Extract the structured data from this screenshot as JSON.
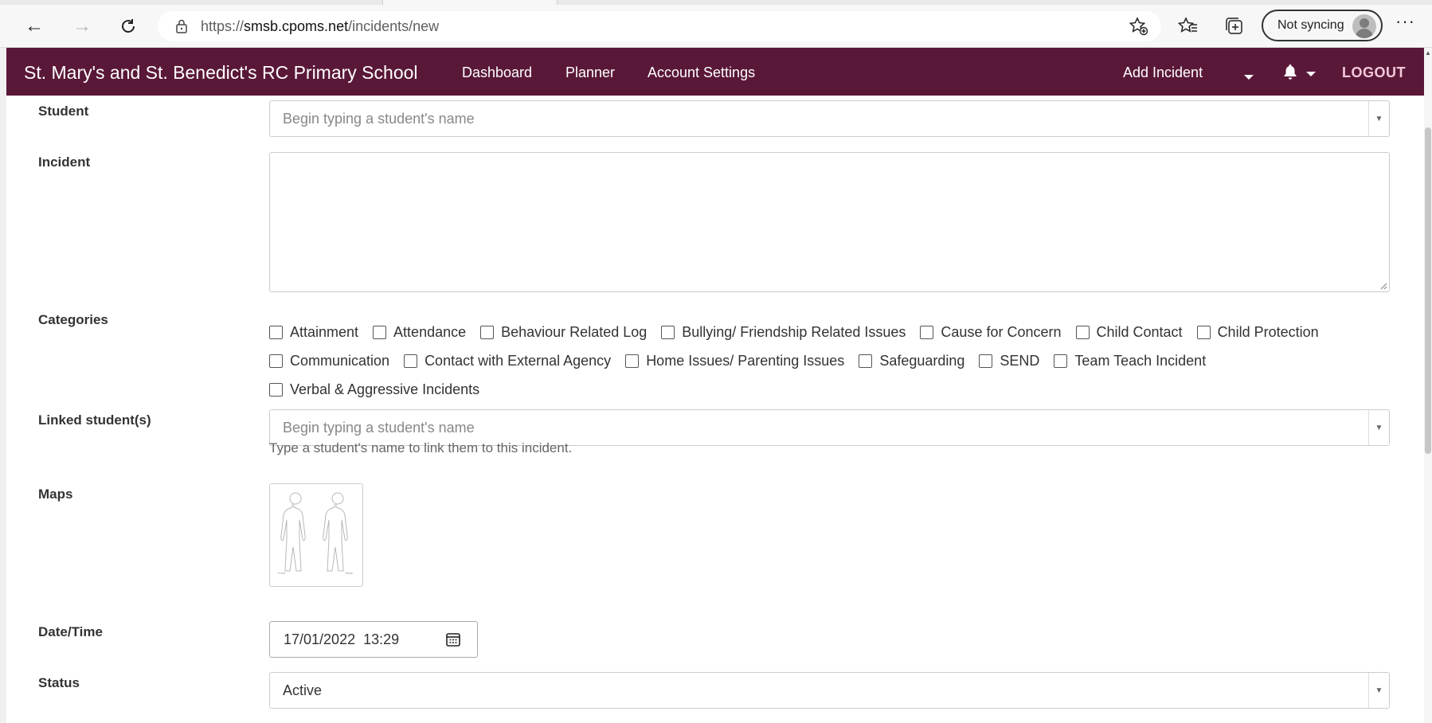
{
  "browser": {
    "url_scheme": "https://",
    "url_host": "smsb.cpoms.net",
    "url_path": "/incidents/new",
    "sync_label": "Not syncing",
    "more_label": "···",
    "icons": [
      "back-arrow-icon",
      "forward-arrow-icon",
      "reload-icon",
      "lock-icon",
      "add-favorite-icon",
      "favorites-icon",
      "collections-icon",
      "profile-avatar-icon"
    ]
  },
  "navbar": {
    "brand": "St. Mary's and St. Benedict's RC Primary School",
    "links": [
      "Dashboard",
      "Planner",
      "Account Settings"
    ],
    "add_incident": "Add Incident",
    "logout": "LOGOUT",
    "background": "#5a1838"
  },
  "form": {
    "student_label": "Student",
    "student_placeholder": "Begin typing a student's name",
    "incident_label": "Incident",
    "categories_label": "Categories",
    "categories": [
      "Attainment",
      "Attendance",
      "Behaviour Related Log",
      "Bullying/ Friendship Related Issues",
      "Cause for Concern",
      "Child Contact",
      "Child Protection",
      "Communication",
      "Contact with External Agency",
      "Home Issues/ Parenting Issues",
      "Safeguarding",
      "SEND",
      "Team Teach Incident",
      "Verbal & Aggressive Incidents"
    ],
    "linked_label": "Linked student(s)",
    "linked_placeholder": "Begin typing a student's name",
    "linked_help": "Type a student's name to link them to this incident.",
    "maps_label": "Maps",
    "datetime_label": "Date/Time",
    "datetime_value": "17/01/2022  13:29",
    "status_label": "Status",
    "status_value": "Active"
  }
}
